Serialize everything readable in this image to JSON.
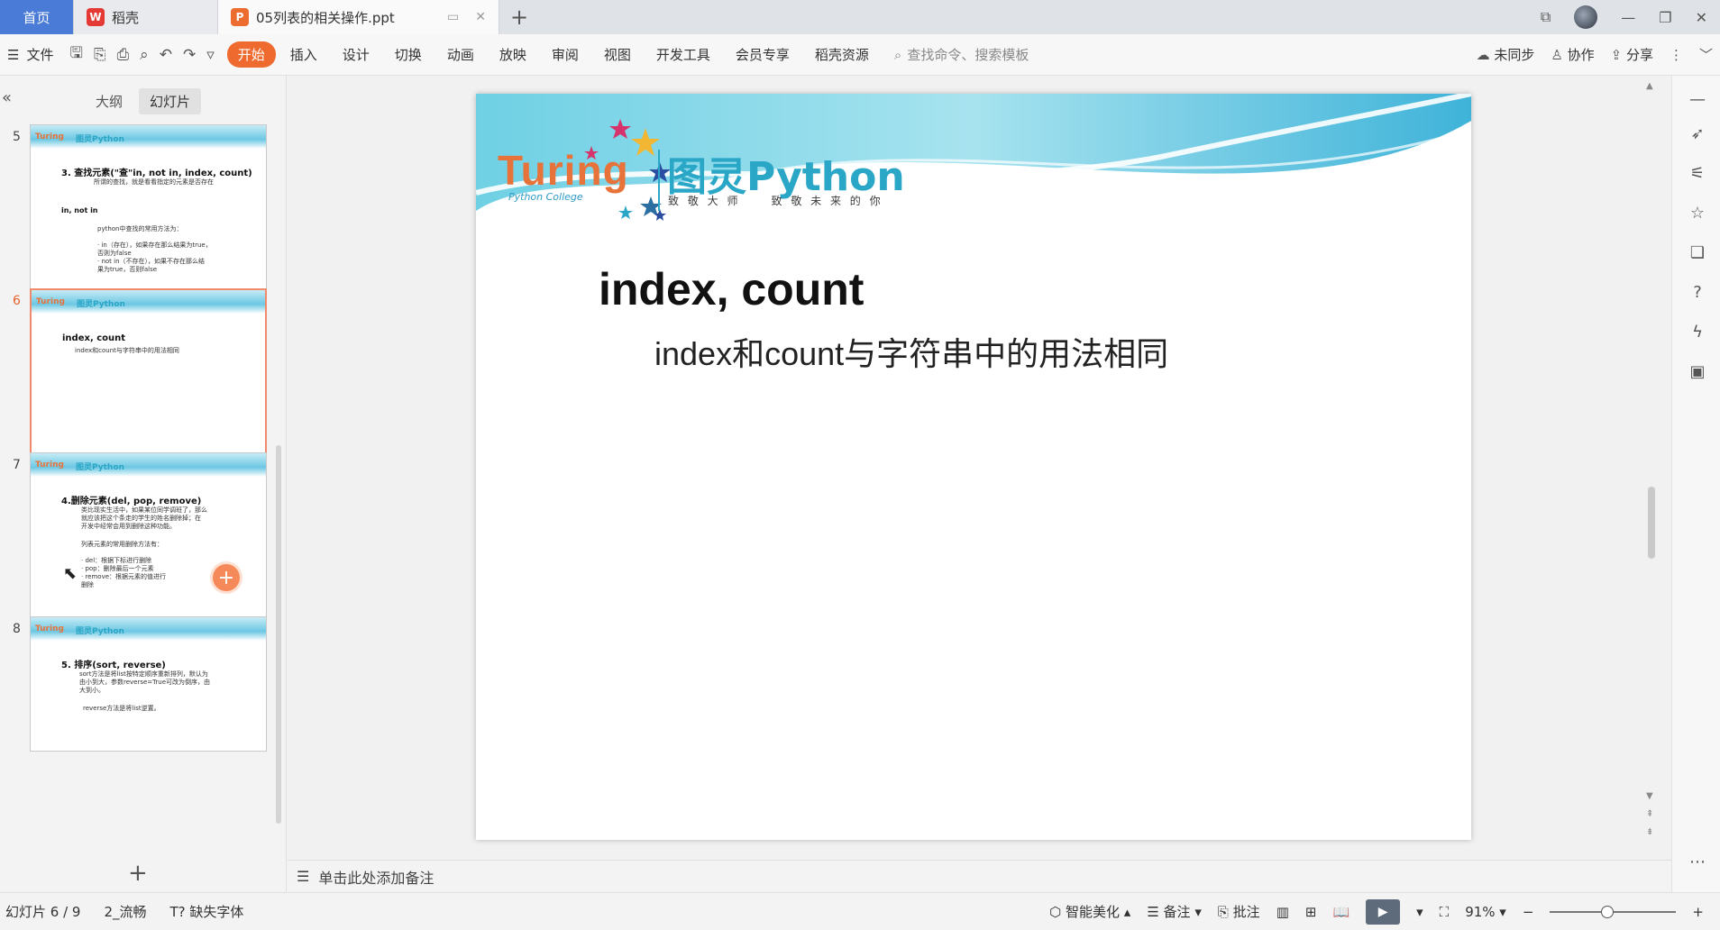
{
  "tabs": {
    "home": "首页",
    "wps": "稻壳",
    "doc": "05列表的相关操作.ppt",
    "new": "+"
  },
  "ribbon": {
    "file": "文件",
    "menu": [
      "开始",
      "插入",
      "设计",
      "切换",
      "动画",
      "放映",
      "审阅",
      "视图",
      "开发工具",
      "会员专享",
      "稻壳资源"
    ],
    "active_menu": "开始",
    "search_placeholder": "查找命令、搜索模板",
    "sync": "未同步",
    "collab": "协作",
    "share": "分享"
  },
  "left_panel": {
    "tab_outline": "大纲",
    "tab_slides": "幻灯片",
    "thumbnails": [
      {
        "number": "5",
        "title": "3. 查找元素(\"查\"in, not in, index, count)",
        "lines": [
          "所谓的查找，就是看看指定的元素是否存在",
          "in, not in",
          "python中查找的常用方法为：",
          "· in（存在），如果存在那么结果为true，",
          "否则为false",
          "· not in（不存在），如果不存在那么结",
          "果为true，否则false"
        ]
      },
      {
        "number": "6",
        "title": "index, count",
        "lines": [
          "index和count与字符串中的用法相同"
        ]
      },
      {
        "number": "7",
        "title": "4.删除元素(del, pop, remove)",
        "lines": [
          "类比现实生活中，如果某位同学调班了，那么",
          "就应该把这个条走的学生的姓名删除掉；在",
          "开发中经常会用到删除这种功能。",
          "列表元素的常用删除方法有：",
          "· del：根据下标进行删除",
          "· pop：删除最后一个元素",
          "· remove：根据元素的值进行",
          "删除"
        ]
      },
      {
        "number": "8",
        "title": "5. 排序(sort, reverse)",
        "lines": [
          "sort方法是将list按特定顺序重新排列，默认为",
          "由小到大，参数reverse=True可改为倒序，由",
          "大到小。",
          "reverse方法是将list逆置。"
        ]
      }
    ],
    "thumb_brand_left": "Turing",
    "thumb_brand_right": "图灵Python"
  },
  "slide": {
    "brand_turing": "Turing",
    "brand_college": "Python College",
    "brand_python": "图灵Python",
    "brand_slogan": "致 敬 大 师     致 敬 未 来 的 你",
    "title": "index, count",
    "body": "index和count与字符串中的用法相同"
  },
  "notes": {
    "placeholder": "单击此处添加备注"
  },
  "status": {
    "slide_counter": "幻灯片 6 / 9",
    "theme": "2_流畅",
    "missing_font": "缺失字体",
    "beautify": "智能美化",
    "notes_btn": "备注",
    "comment_btn": "批注",
    "zoom": "91%",
    "zoom_level": 0.45
  },
  "colors": {
    "accent": "#ee6a2f",
    "home_tab": "#4a7bd6",
    "brand_orange": "#e8733a",
    "brand_blue": "#2aa6c6"
  }
}
